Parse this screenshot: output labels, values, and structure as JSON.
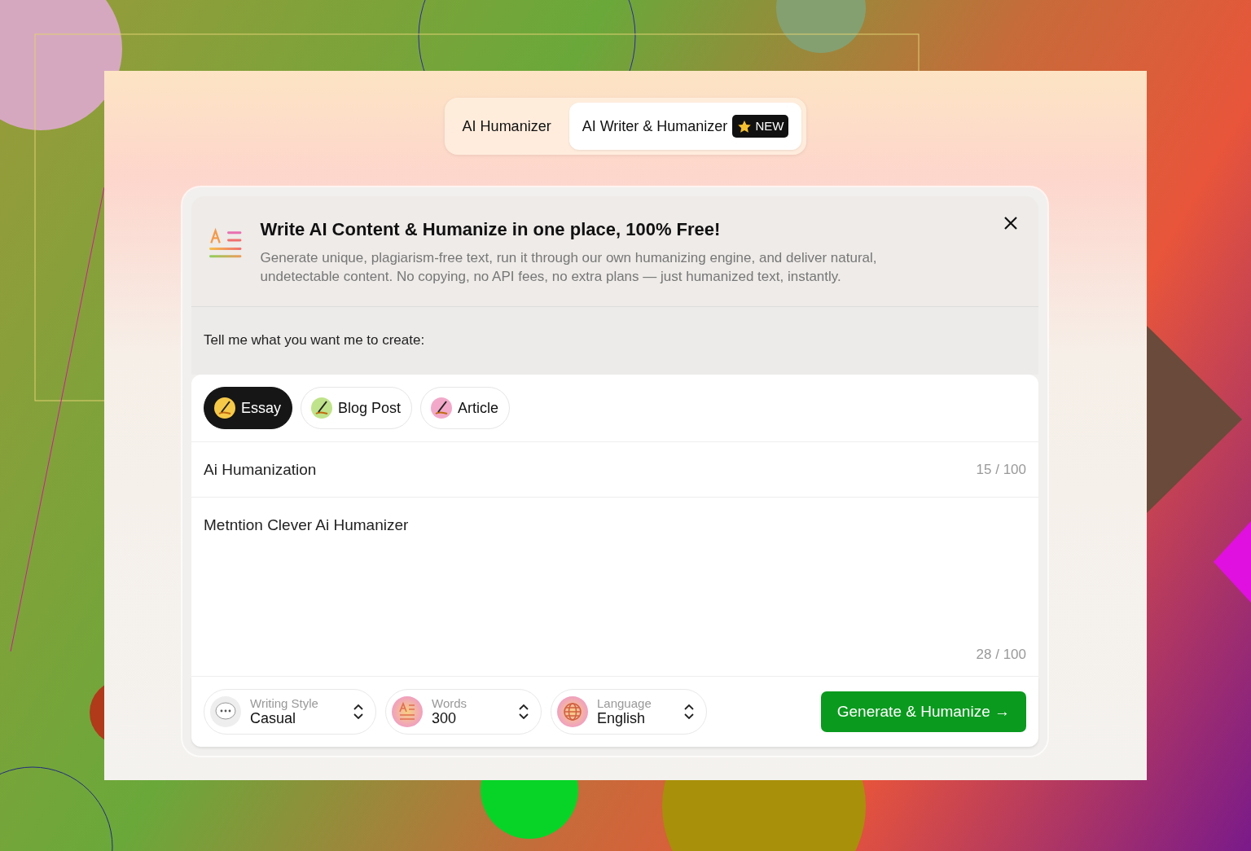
{
  "tabs": [
    {
      "label": "AI Humanizer",
      "selected": false
    },
    {
      "label": "AI Writer & Humanizer",
      "selected": true,
      "badge": "NEW"
    }
  ],
  "banner": {
    "title": "Write AI Content & Humanize in one place, 100% Free!",
    "text": "Generate unique, plagiarism-free text, run it through our own humanizing engine, and deliver natural, undetectable content. No copying, no API fees, no extra plans — just humanized text, instantly."
  },
  "prompt_label": "Tell me what you want me to create:",
  "content_types": [
    {
      "label": "Essay",
      "selected": true,
      "color": "#f7c948"
    },
    {
      "label": "Blog Post",
      "selected": false,
      "color": "#bfe38a"
    },
    {
      "label": "Article",
      "selected": false,
      "color": "#f2a9c9"
    }
  ],
  "topic": {
    "value": "Ai Humanization",
    "counter": "15 / 100"
  },
  "details": {
    "value": "Metntion Clever Ai Humanizer",
    "counter": "28 / 100"
  },
  "selectors": [
    {
      "kind": "style",
      "label": "Writing Style",
      "value": "Casual"
    },
    {
      "kind": "words",
      "label": "Words",
      "value": "300"
    },
    {
      "kind": "language",
      "label": "Language",
      "value": "English"
    }
  ],
  "generate_button": "Generate & Humanize →"
}
